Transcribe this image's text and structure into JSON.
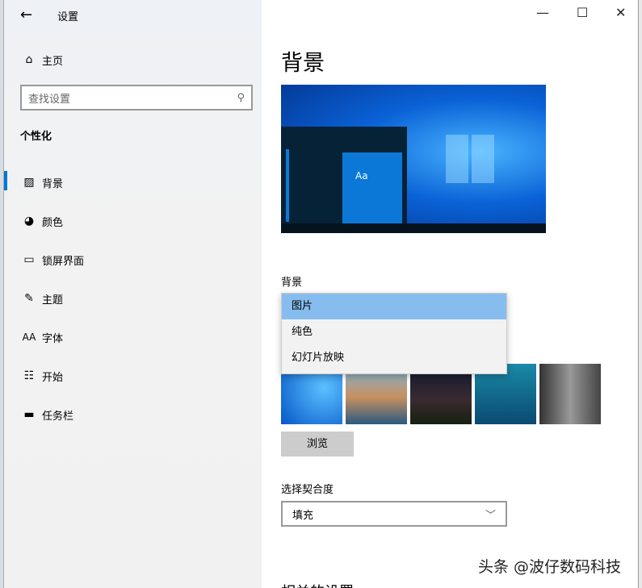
{
  "window": {
    "title": "设置",
    "back_icon": "arrow-left-icon",
    "minimize": "—",
    "maximize": "☐",
    "close": "✕"
  },
  "sidebar": {
    "home": "主页",
    "search_placeholder": "查找设置",
    "section": "个性化",
    "items": [
      {
        "label": "背景",
        "icon": "image-icon"
      },
      {
        "label": "颜色",
        "icon": "palette-icon"
      },
      {
        "label": "锁屏界面",
        "icon": "lock-screen-icon"
      },
      {
        "label": "主题",
        "icon": "theme-icon"
      },
      {
        "label": "字体",
        "icon": "font-icon"
      },
      {
        "label": "开始",
        "icon": "start-icon"
      },
      {
        "label": "任务栏",
        "icon": "taskbar-icon"
      }
    ],
    "selected": "背景"
  },
  "main": {
    "title": "背景",
    "preview_tile": "Aa",
    "background_label": "背景",
    "dropdown_options": [
      "图片",
      "纯色",
      "幻灯片放映"
    ],
    "dropdown_selected": "图片",
    "browse": "浏览",
    "fit_label": "选择契合度",
    "fit_value": "填充",
    "related": "相关的设置"
  },
  "watermark": "头条 @波仔数码科技",
  "colors": {
    "accent": "#0078d7",
    "highlight": "#86bdee"
  }
}
